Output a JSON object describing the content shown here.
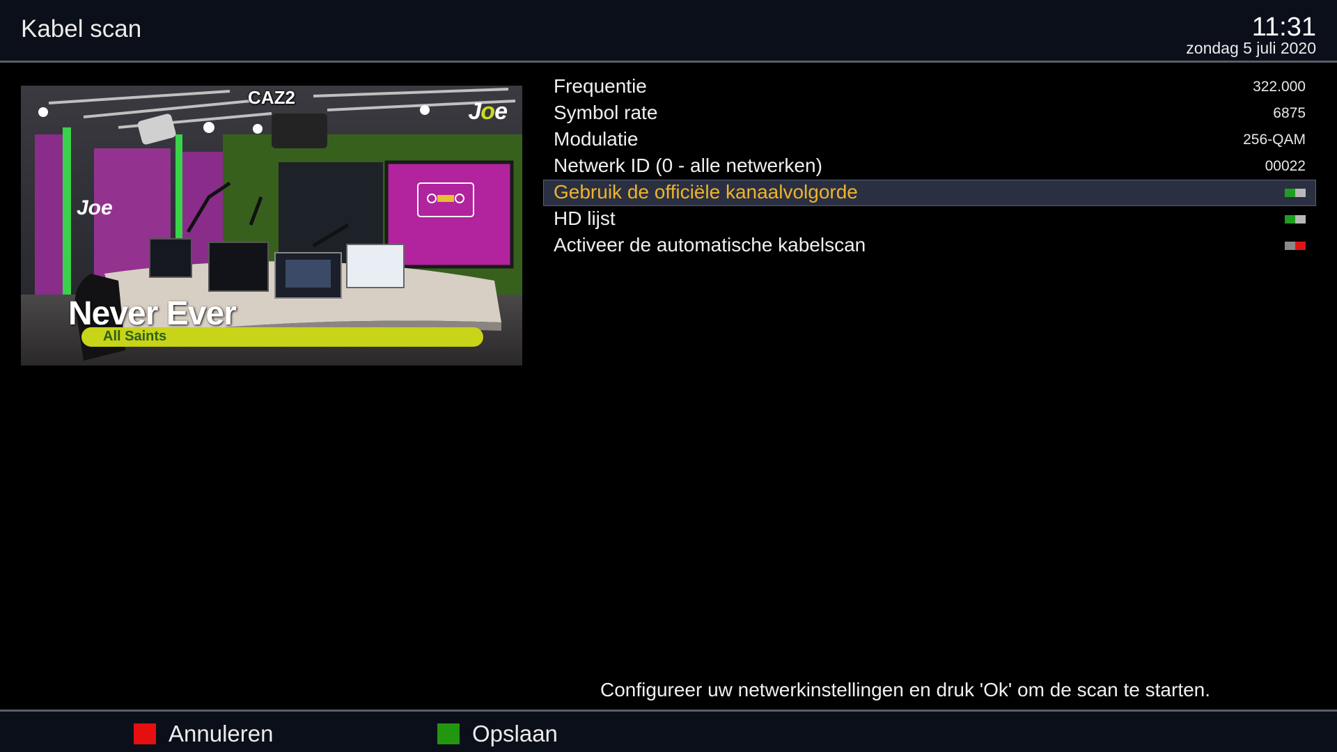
{
  "header": {
    "title": "Kabel scan",
    "time": "11:31",
    "date": "zondag 5 juli 2020"
  },
  "preview": {
    "channel": "CAZ2",
    "logo_prefix": "J",
    "logo_dot": "o",
    "logo_suffix": "e",
    "wall_logo": "Joe",
    "song_title": "Never Ever",
    "song_artist": "All Saints"
  },
  "menu": {
    "items": [
      {
        "label": "Frequentie",
        "value": "322.000"
      },
      {
        "label": "Symbol rate",
        "value": "6875"
      },
      {
        "label": "Modulatie",
        "value": "256-QAM"
      },
      {
        "label": "Netwerk ID (0 - alle netwerken)",
        "value": "00022"
      },
      {
        "label": "Gebruik de officiële kanaalvolgorde",
        "toggle": "on",
        "selected": true
      },
      {
        "label": "HD lijst",
        "toggle": "on"
      },
      {
        "label": "Activeer de automatische kabelscan",
        "toggle": "off"
      }
    ]
  },
  "help_text": "Configureer uw netwerkinstellingen en druk 'Ok' om de scan te starten.",
  "footer": {
    "red_label": "Annuleren",
    "green_label": "Opslaan"
  },
  "colors": {
    "selected_text": "#f0b428",
    "key_red": "#e60f0f",
    "key_green": "#22960e",
    "toggle_on": "#1f9e1f",
    "toggle_off": "#e01414",
    "toggle_neutral": "#b8b8b8"
  }
}
